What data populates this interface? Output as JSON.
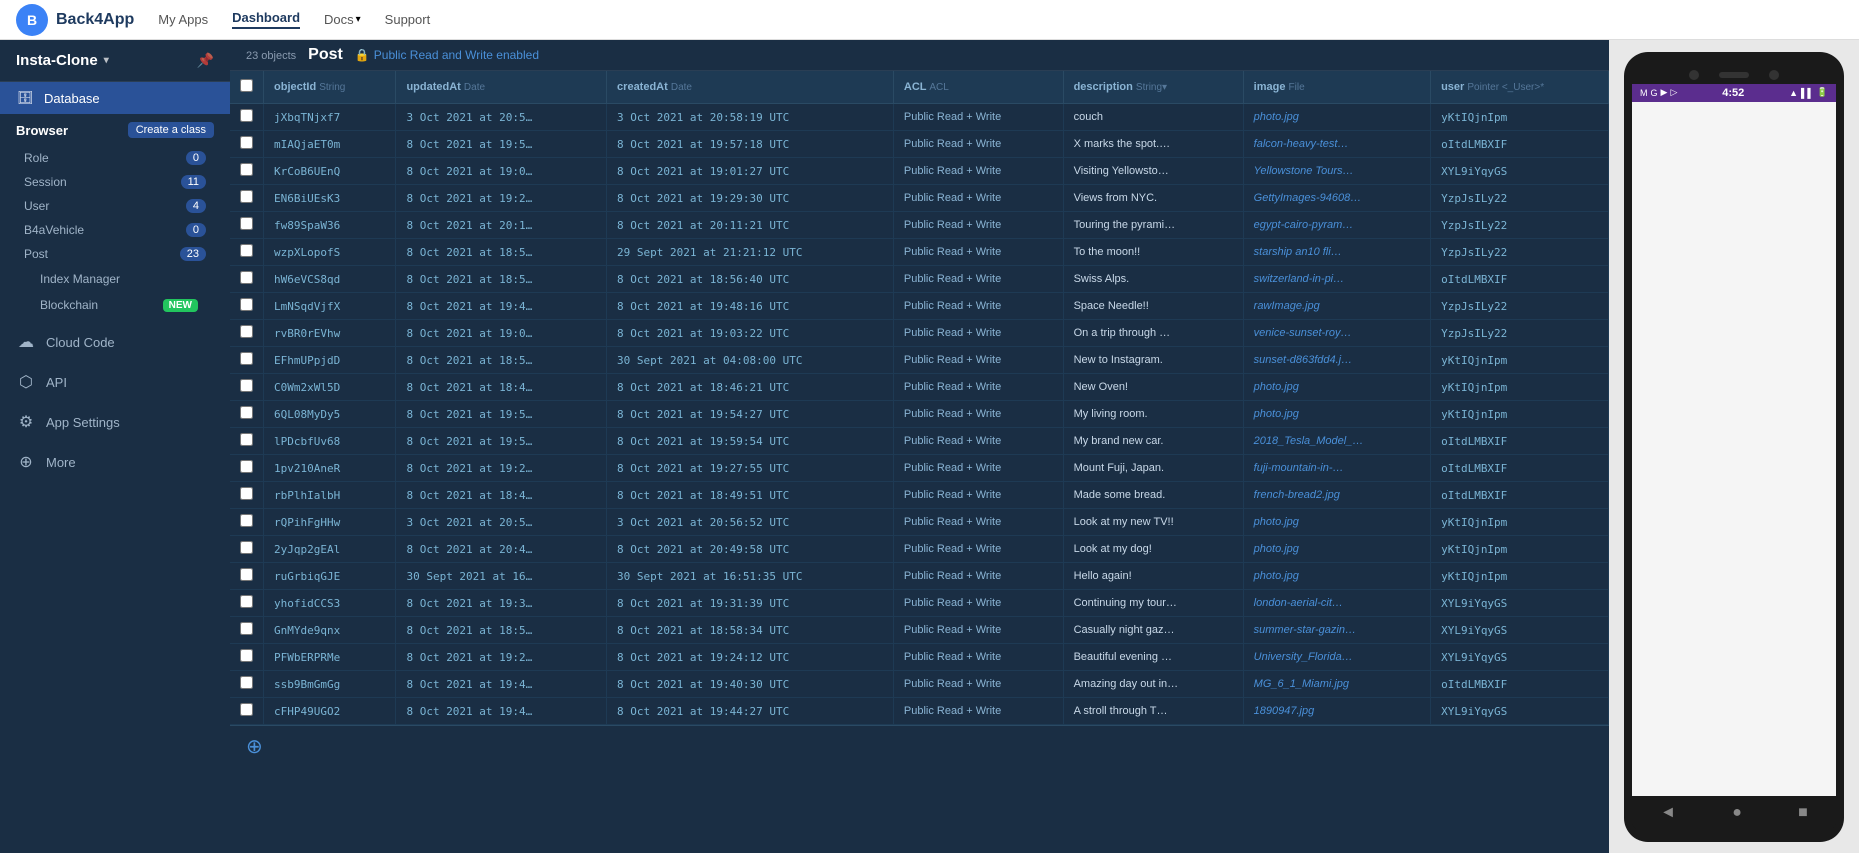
{
  "topNav": {
    "logoText": "Back4App",
    "links": [
      "My Apps",
      "Dashboard",
      "Docs",
      "Support"
    ]
  },
  "sidebar": {
    "appName": "Insta-Clone",
    "sections": {
      "database": "Database",
      "browser": "Browser",
      "createClass": "Create a class",
      "classes": [
        {
          "name": "Role",
          "count": "0"
        },
        {
          "name": "Session",
          "count": "11"
        },
        {
          "name": "User",
          "count": "4"
        },
        {
          "name": "B4aVehicle",
          "count": "0"
        },
        {
          "name": "Post",
          "count": "23"
        }
      ],
      "indexManager": "Index Manager",
      "blockchain": "Blockchain",
      "newBadge": "NEW"
    },
    "navItems": [
      {
        "label": "Cloud Code",
        "icon": "☁"
      },
      {
        "label": "API",
        "icon": "🔗"
      },
      {
        "label": "App Settings",
        "icon": "⚙"
      },
      {
        "label": "More",
        "icon": "⊕"
      }
    ]
  },
  "tableArea": {
    "objectCount": "23 objects",
    "className": "Post",
    "publicReadWrite": "Public Read and Write enabled",
    "columns": [
      {
        "name": "objectId",
        "type": "String"
      },
      {
        "name": "updatedAt",
        "type": "Date"
      },
      {
        "name": "createdAt",
        "type": "Date"
      },
      {
        "name": "ACL",
        "type": "ACL"
      },
      {
        "name": "description",
        "type": "String"
      },
      {
        "name": "image",
        "type": "File"
      },
      {
        "name": "user",
        "type": "Pointer<_User>"
      }
    ],
    "rows": [
      {
        "objectId": "jXbqTNjxf7",
        "updatedAt": "3 Oct 2021 at 20:5…",
        "createdAt": "3 Oct 2021 at 20:58:19 UTC",
        "acl": "Public Read + Write",
        "description": "couch",
        "image": "photo.jpg",
        "user": "yKtIQjnIpm"
      },
      {
        "objectId": "mIAQjaET0m",
        "updatedAt": "8 Oct 2021 at 19:5…",
        "createdAt": "8 Oct 2021 at 19:57:18 UTC",
        "acl": "Public Read + Write",
        "description": "X marks the spot.…",
        "image": "falcon-heavy-test…",
        "user": "oItdLMBXIF"
      },
      {
        "objectId": "KrCoB6UEnQ",
        "updatedAt": "8 Oct 2021 at 19:0…",
        "createdAt": "8 Oct 2021 at 19:01:27 UTC",
        "acl": "Public Read + Write",
        "description": "Visiting Yellowsto…",
        "image": "Yellowstone Tours…",
        "user": "XYL9iYqyGS"
      },
      {
        "objectId": "EN6BiUEsK3",
        "updatedAt": "8 Oct 2021 at 19:2…",
        "createdAt": "8 Oct 2021 at 19:29:30 UTC",
        "acl": "Public Read + Write",
        "description": "Views from NYC.",
        "image": "GettyImages-94608…",
        "user": "YzpJsILy22"
      },
      {
        "objectId": "fw89SpaW36",
        "updatedAt": "8 Oct 2021 at 20:1…",
        "createdAt": "8 Oct 2021 at 20:11:21 UTC",
        "acl": "Public Read + Write",
        "description": "Touring the pyrami…",
        "image": "egypt-cairo-pyram…",
        "user": "YzpJsILy22"
      },
      {
        "objectId": "wzpXLopofS",
        "updatedAt": "8 Oct 2021 at 18:5…",
        "createdAt": "29 Sept 2021 at 21:21:12 UTC",
        "acl": "Public Read + Write",
        "description": "To the moon!!",
        "image": "starship an10 fli…",
        "user": "YzpJsILy22"
      },
      {
        "objectId": "hW6eVCS8qd",
        "updatedAt": "8 Oct 2021 at 18:5…",
        "createdAt": "8 Oct 2021 at 18:56:40 UTC",
        "acl": "Public Read + Write",
        "description": "Swiss Alps.",
        "image": "switzerland-in-pi…",
        "user": "oItdLMBXIF"
      },
      {
        "objectId": "LmNSqdVjfX",
        "updatedAt": "8 Oct 2021 at 19:4…",
        "createdAt": "8 Oct 2021 at 19:48:16 UTC",
        "acl": "Public Read + Write",
        "description": "Space Needle!!",
        "image": "rawImage.jpg",
        "user": "YzpJsILy22"
      },
      {
        "objectId": "rvBR0rEVhw",
        "updatedAt": "8 Oct 2021 at 19:0…",
        "createdAt": "8 Oct 2021 at 19:03:22 UTC",
        "acl": "Public Read + Write",
        "description": "On a trip through …",
        "image": "venice-sunset-roy…",
        "user": "YzpJsILy22"
      },
      {
        "objectId": "EFhmUPpjdD",
        "updatedAt": "8 Oct 2021 at 18:5…",
        "createdAt": "30 Sept 2021 at 04:08:00 UTC",
        "acl": "Public Read + Write",
        "description": "New to Instagram.",
        "image": "sunset-d863fdd4.j…",
        "user": "yKtIQjnIpm"
      },
      {
        "objectId": "C0Wm2xWl5D",
        "updatedAt": "8 Oct 2021 at 18:4…",
        "createdAt": "8 Oct 2021 at 18:46:21 UTC",
        "acl": "Public Read + Write",
        "description": "New Oven!",
        "image": "photo.jpg",
        "user": "yKtIQjnIpm"
      },
      {
        "objectId": "6QL08MyDy5",
        "updatedAt": "8 Oct 2021 at 19:5…",
        "createdAt": "8 Oct 2021 at 19:54:27 UTC",
        "acl": "Public Read + Write",
        "description": "My living room.",
        "image": "photo.jpg",
        "user": "yKtIQjnIpm"
      },
      {
        "objectId": "lPDcbfUv68",
        "updatedAt": "8 Oct 2021 at 19:5…",
        "createdAt": "8 Oct 2021 at 19:59:54 UTC",
        "acl": "Public Read + Write",
        "description": "My brand new car.",
        "image": "2018_Tesla_Model_…",
        "user": "oItdLMBXIF"
      },
      {
        "objectId": "1pv210AneR",
        "updatedAt": "8 Oct 2021 at 19:2…",
        "createdAt": "8 Oct 2021 at 19:27:55 UTC",
        "acl": "Public Read + Write",
        "description": "Mount Fuji, Japan.",
        "image": "fuji-mountain-in-…",
        "user": "oItdLMBXIF"
      },
      {
        "objectId": "rbPlhIalbH",
        "updatedAt": "8 Oct 2021 at 18:4…",
        "createdAt": "8 Oct 2021 at 18:49:51 UTC",
        "acl": "Public Read + Write",
        "description": "Made some bread.",
        "image": "french-bread2.jpg",
        "user": "oItdLMBXIF"
      },
      {
        "objectId": "rQPihFgHHw",
        "updatedAt": "3 Oct 2021 at 20:5…",
        "createdAt": "3 Oct 2021 at 20:56:52 UTC",
        "acl": "Public Read + Write",
        "description": "Look at my new TV!!",
        "image": "photo.jpg",
        "user": "yKtIQjnIpm"
      },
      {
        "objectId": "2yJqp2gEAl",
        "updatedAt": "8 Oct 2021 at 20:4…",
        "createdAt": "8 Oct 2021 at 20:49:58 UTC",
        "acl": "Public Read + Write",
        "description": "Look at my dog!",
        "image": "photo.jpg",
        "user": "yKtIQjnIpm"
      },
      {
        "objectId": "ruGrbiqGJE",
        "updatedAt": "30 Sept 2021 at 16…",
        "createdAt": "30 Sept 2021 at 16:51:35 UTC",
        "acl": "Public Read + Write",
        "description": "Hello again!",
        "image": "photo.jpg",
        "user": "yKtIQjnIpm"
      },
      {
        "objectId": "yhofidCCS3",
        "updatedAt": "8 Oct 2021 at 19:3…",
        "createdAt": "8 Oct 2021 at 19:31:39 UTC",
        "acl": "Public Read + Write",
        "description": "Continuing my tour…",
        "image": "london-aerial-cit…",
        "user": "XYL9iYqyGS"
      },
      {
        "objectId": "GnMYde9qnx",
        "updatedAt": "8 Oct 2021 at 18:5…",
        "createdAt": "8 Oct 2021 at 18:58:34 UTC",
        "acl": "Public Read + Write",
        "description": "Casually night gaz…",
        "image": "summer-star-gazin…",
        "user": "XYL9iYqyGS"
      },
      {
        "objectId": "PFWbERPRMe",
        "updatedAt": "8 Oct 2021 at 19:2…",
        "createdAt": "8 Oct 2021 at 19:24:12 UTC",
        "acl": "Public Read + Write",
        "description": "Beautiful evening …",
        "image": "University_Florida…",
        "user": "XYL9iYqyGS"
      },
      {
        "objectId": "ssb9BmGmGg",
        "updatedAt": "8 Oct 2021 at 19:4…",
        "createdAt": "8 Oct 2021 at 19:40:30 UTC",
        "acl": "Public Read + Write",
        "description": "Amazing day out in…",
        "image": "MG_6_1_Miami.jpg",
        "user": "oItdLMBXIF"
      },
      {
        "objectId": "cFHP49UGO2",
        "updatedAt": "8 Oct 2021 at 19:4…",
        "createdAt": "8 Oct 2021 at 19:44:27 UTC",
        "acl": "Public Read + Write",
        "description": "A stroll through T…",
        "image": "1890947.jpg",
        "user": "XYL9iYqyGS"
      }
    ]
  },
  "phone": {
    "time": "4:52",
    "statusIcons": "▲ WiFi ▌▌ 🔋"
  }
}
